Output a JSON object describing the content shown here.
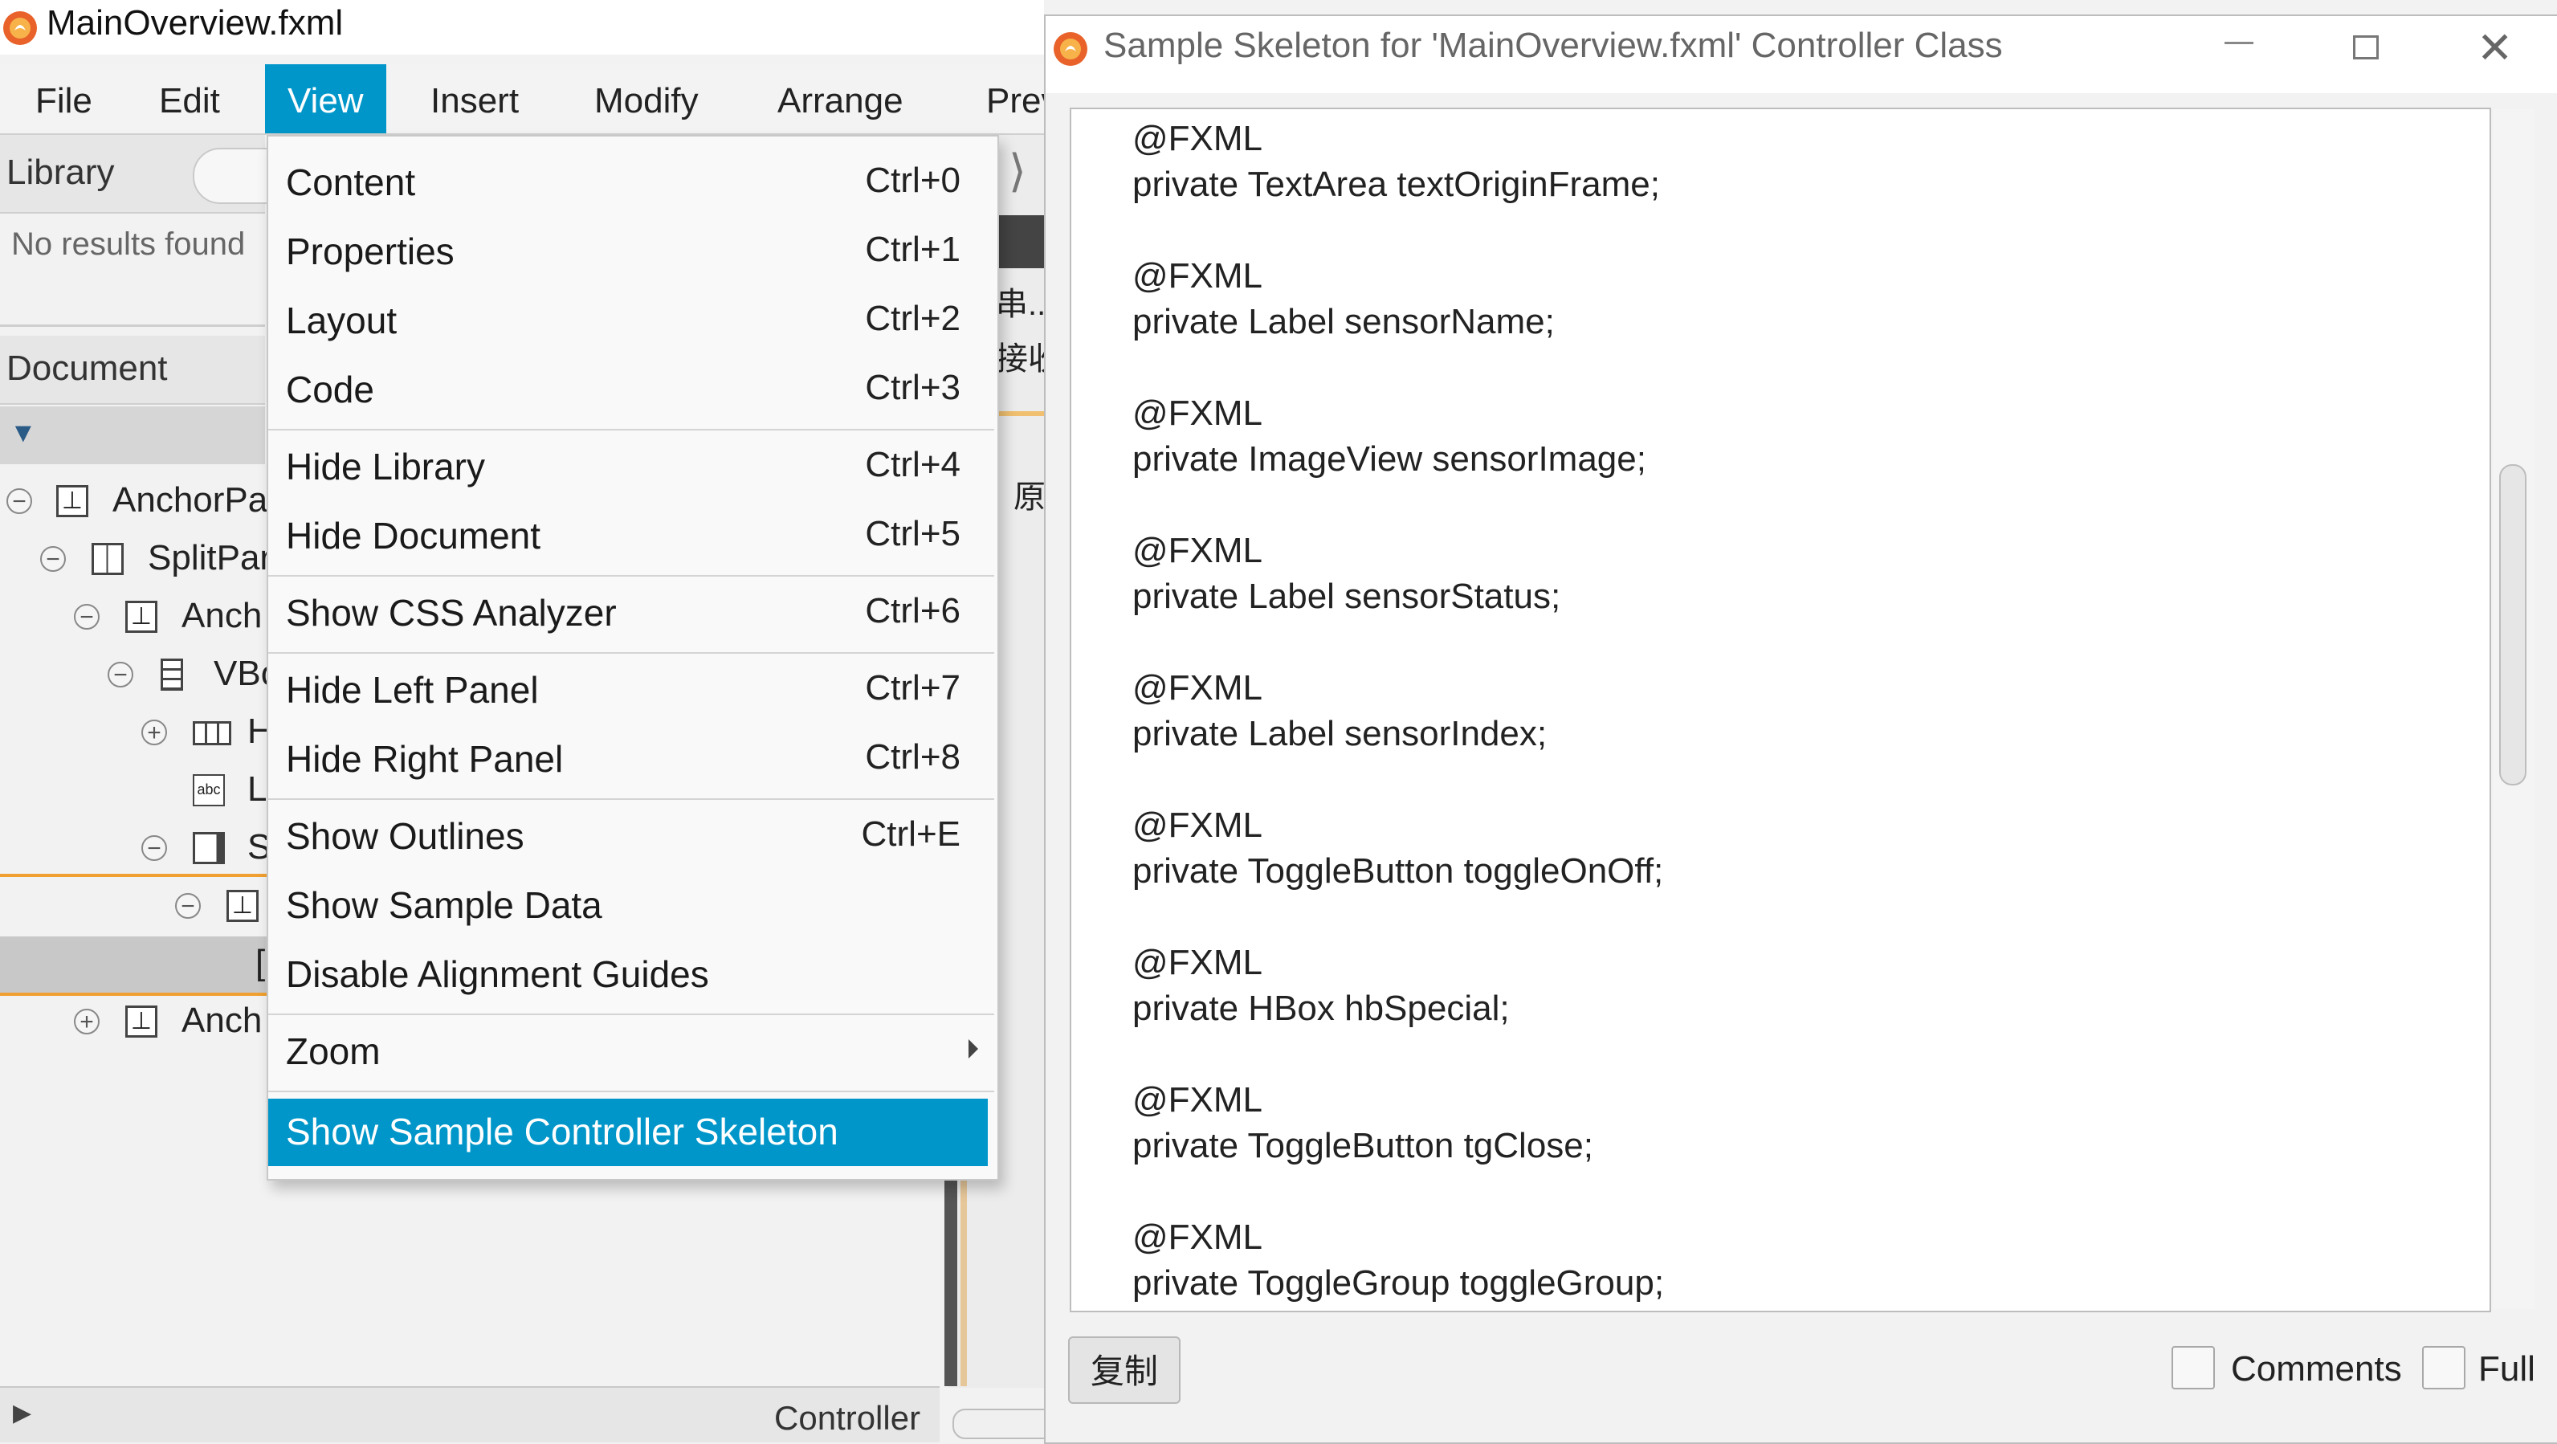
{
  "main_window": {
    "title": "MainOverview.fxml",
    "menubar": [
      "File",
      "Edit",
      "View",
      "Insert",
      "Modify",
      "Arrange",
      "Prev"
    ],
    "active_menu": "View",
    "accent_color": "#0096c9"
  },
  "library": {
    "label": "Library",
    "no_results": "No results found"
  },
  "document": {
    "label": "Document",
    "tree": [
      {
        "label": "AnchorPa",
        "toggle": "−",
        "icon": "anchorpane-icon"
      },
      {
        "label": "SplitPar",
        "toggle": "−",
        "icon": "splitpane-icon"
      },
      {
        "label": "Anch",
        "toggle": "−",
        "icon": "anchorpane-icon"
      },
      {
        "label": "VBo",
        "toggle": "−",
        "icon": "vbox-icon"
      },
      {
        "label": "H",
        "toggle": "+",
        "icon": "hbox-icon"
      },
      {
        "label": "L",
        "toggle": "",
        "icon": "label-icon"
      },
      {
        "label": "S",
        "toggle": "−",
        "icon": "scrollpane-icon"
      },
      {
        "label": "",
        "toggle": "−",
        "icon": "anchorpane-icon"
      },
      {
        "label": "[",
        "toggle": "",
        "icon": ""
      },
      {
        "label": "Anch",
        "toggle": "+",
        "icon": "anchorpane-icon"
      }
    ]
  },
  "content_cjk": [
    "串...",
    "接收",
    "原"
  ],
  "bottom_bar": {
    "controller_label": "Controller"
  },
  "view_menu": {
    "groups": [
      [
        {
          "label": "Content",
          "key": "Ctrl+0"
        },
        {
          "label": "Properties",
          "key": "Ctrl+1"
        },
        {
          "label": "Layout",
          "key": "Ctrl+2"
        },
        {
          "label": "Code",
          "key": "Ctrl+3"
        }
      ],
      [
        {
          "label": "Hide Library",
          "key": "Ctrl+4"
        },
        {
          "label": "Hide Document",
          "key": "Ctrl+5"
        }
      ],
      [
        {
          "label": "Show CSS Analyzer",
          "key": "Ctrl+6"
        }
      ],
      [
        {
          "label": "Hide Left Panel",
          "key": "Ctrl+7"
        },
        {
          "label": "Hide Right Panel",
          "key": "Ctrl+8"
        }
      ],
      [
        {
          "label": "Show Outlines",
          "key": "Ctrl+E"
        },
        {
          "label": "Show Sample Data",
          "key": ""
        },
        {
          "label": "Disable Alignment Guides",
          "key": ""
        }
      ],
      [
        {
          "label": "Zoom",
          "key": "",
          "submenu": true
        }
      ],
      [
        {
          "label": "Show Sample Controller Skeleton",
          "key": "",
          "highlighted": true
        }
      ]
    ]
  },
  "dialog": {
    "title": "Sample Skeleton for 'MainOverview.fxml' Controller Class",
    "code_lines": [
      "@FXML",
      "private TextArea textOriginFrame;",
      "",
      "@FXML",
      "private Label sensorName;",
      "",
      "@FXML",
      "private ImageView sensorImage;",
      "",
      "@FXML",
      "private Label sensorStatus;",
      "",
      "@FXML",
      "private Label sensorIndex;",
      "",
      "@FXML",
      "private ToggleButton toggleOnOff;",
      "",
      "@FXML",
      "private HBox hbSpecial;",
      "",
      "@FXML",
      "private ToggleButton tgClose;",
      "",
      "@FXML",
      "private ToggleGroup toggleGroup;"
    ],
    "copy_button": "复制",
    "comments_label": "Comments",
    "full_label": "Full",
    "close_glyph": "✕"
  }
}
